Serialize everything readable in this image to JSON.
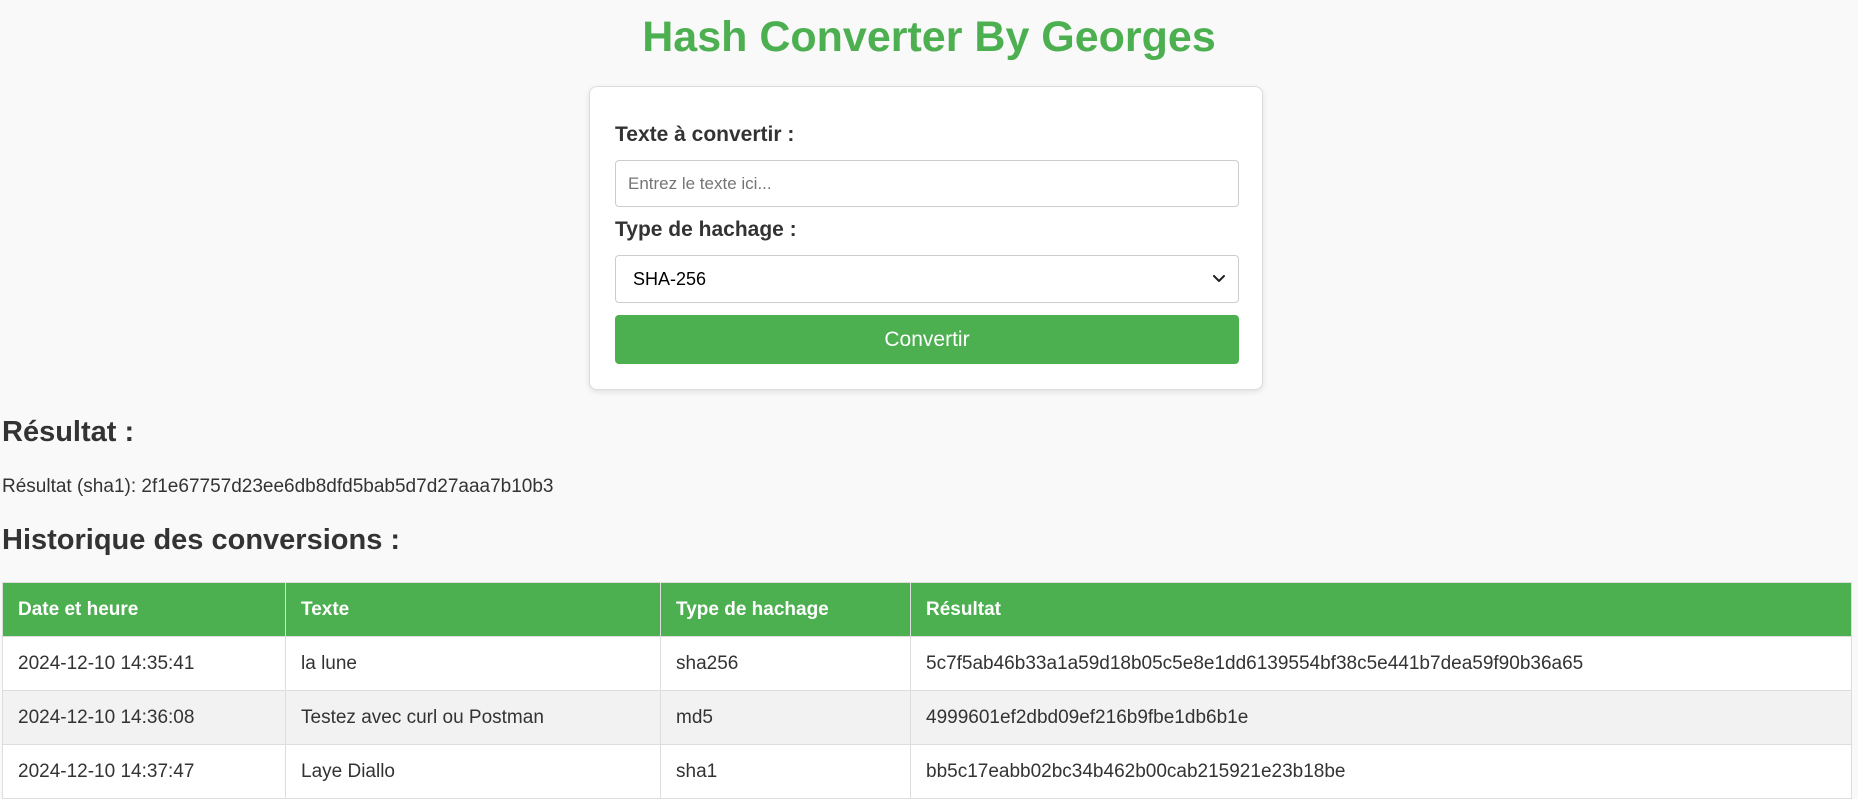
{
  "header": {
    "title": "Hash Converter By Georges"
  },
  "form": {
    "text_label": "Texte à convertir :",
    "text_placeholder": "Entrez le texte ici...",
    "text_value": "",
    "hash_label": "Type de hachage :",
    "hash_selected": "SHA-256",
    "chevron_icon": "chevron-down-icon",
    "convert_label": "Convertir",
    "accent_color": "#4caf50"
  },
  "result": {
    "heading": "Résultat :",
    "text": "Résultat (sha1): 2f1e67757d23ee6db8dfd5bab5d7d27aaa7b10b3"
  },
  "history": {
    "heading": "Historique des conversions :",
    "columns": [
      "Date et heure",
      "Texte",
      "Type de hachage",
      "Résultat"
    ],
    "rows": [
      [
        "2024-12-10 14:35:41",
        "la lune",
        "sha256",
        "5c7f5ab46b33a1a59d18b05c5e8e1dd6139554bf38c5e441b7dea59f90b36a65"
      ],
      [
        "2024-12-10 14:36:08",
        "Testez avec curl ou Postman",
        "md5",
        "4999601ef2dbd09ef216b9fbe1db6b1e"
      ],
      [
        "2024-12-10 14:37:47",
        "Laye Diallo",
        "sha1",
        "bb5c17eabb02bc34b462b00cab215921e23b18be"
      ]
    ]
  }
}
